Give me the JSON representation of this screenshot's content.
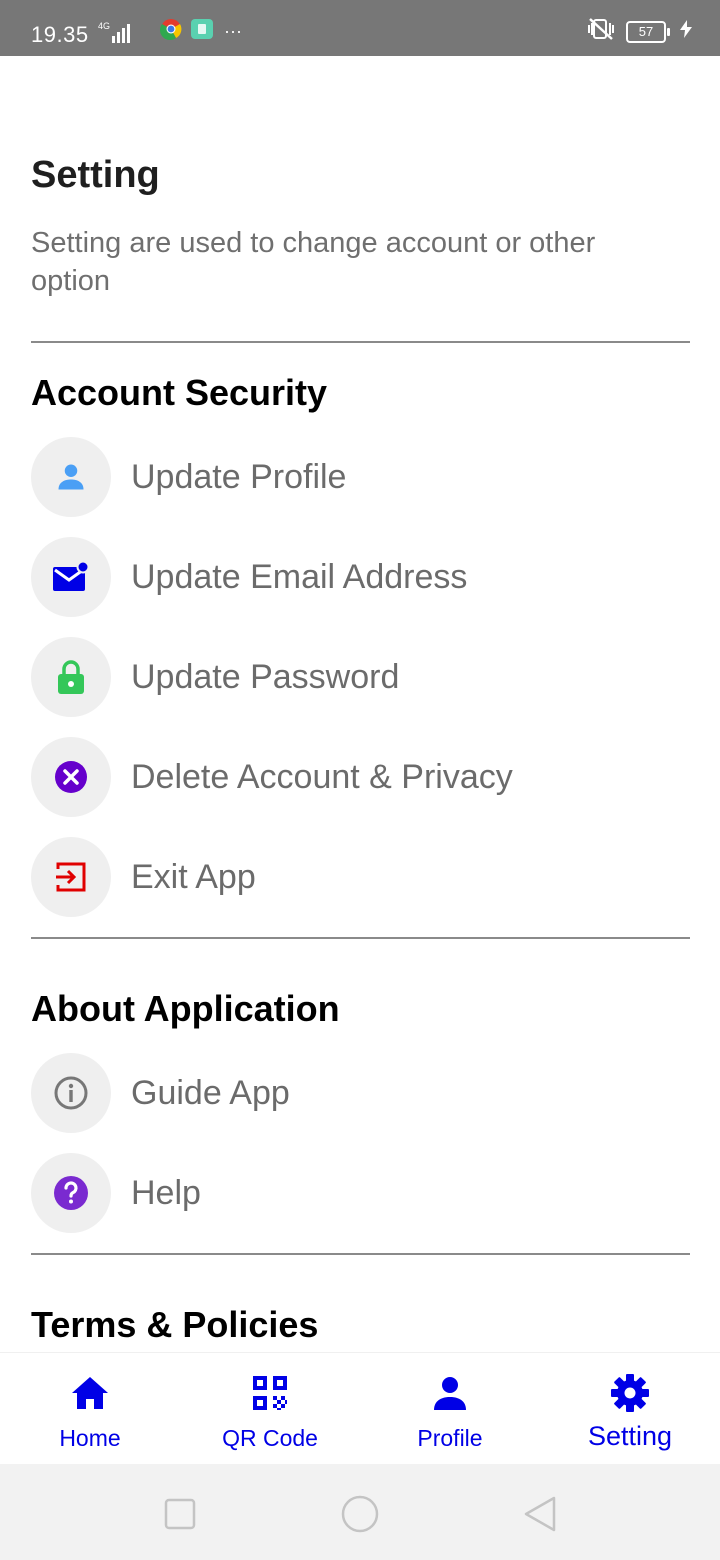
{
  "status_bar": {
    "time": "19.35",
    "network": "4G",
    "battery": "57"
  },
  "header": {
    "title": "Setting",
    "description": "Setting are used to change account or other option"
  },
  "sections": {
    "account_security": {
      "title": "Account Security",
      "items": [
        {
          "label": "Update Profile",
          "icon": "person-icon",
          "color": "#4a9ff5"
        },
        {
          "label": "Update Email Address",
          "icon": "email-icon",
          "color": "#0000e6"
        },
        {
          "label": "Update Password",
          "icon": "lock-icon",
          "color": "#34c759"
        },
        {
          "label": "Delete Account & Privacy",
          "icon": "close-circle-icon",
          "color": "#6600cc"
        },
        {
          "label": "Exit App",
          "icon": "exit-icon",
          "color": "#e00000"
        }
      ]
    },
    "about_application": {
      "title": "About Application",
      "items": [
        {
          "label": "Guide App",
          "icon": "info-icon",
          "color": "#777777"
        },
        {
          "label": "Help",
          "icon": "help-icon",
          "color": "#7a2ad0"
        }
      ]
    },
    "terms_policies": {
      "title": "Terms & Policies"
    }
  },
  "bottom_nav": {
    "items": [
      {
        "label": "Home",
        "icon": "home-icon"
      },
      {
        "label": "QR Code",
        "icon": "qr-code-icon"
      },
      {
        "label": "Profile",
        "icon": "person-icon"
      },
      {
        "label": "Setting",
        "icon": "gear-icon",
        "active": true
      }
    ],
    "accent": "#0000e6"
  }
}
